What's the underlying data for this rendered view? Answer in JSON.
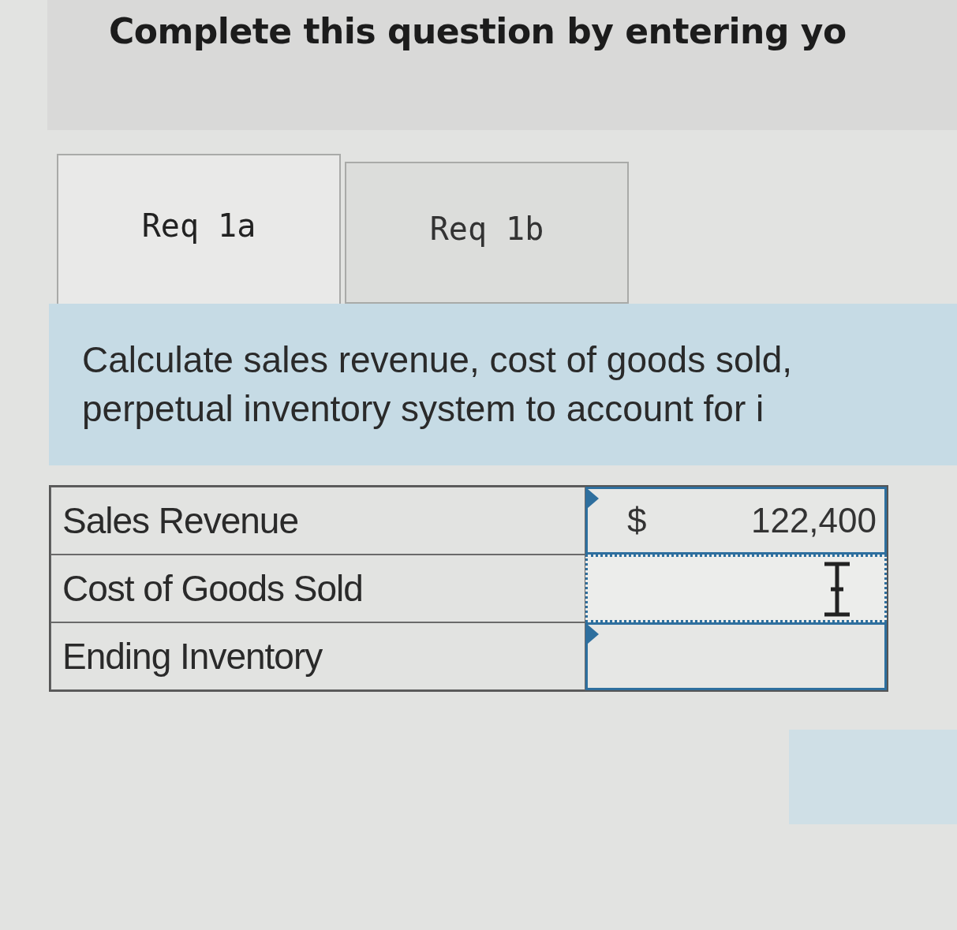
{
  "header": {
    "text": "Complete this question by entering yo"
  },
  "tabs": [
    {
      "label": "Req 1a",
      "selected": true
    },
    {
      "label": "Req 1b",
      "selected": false
    }
  ],
  "instructions": [
    "Calculate sales revenue, cost of goods sold,",
    "perpetual inventory system to account for i"
  ],
  "table": {
    "rows": [
      {
        "label": "Sales Revenue",
        "currency": "$",
        "value": "122,400",
        "focused": false,
        "marker": true
      },
      {
        "label": "Cost of Goods Sold",
        "focused": true,
        "marker": false
      },
      {
        "label": "Ending Inventory",
        "focused": false,
        "marker": true
      }
    ]
  }
}
